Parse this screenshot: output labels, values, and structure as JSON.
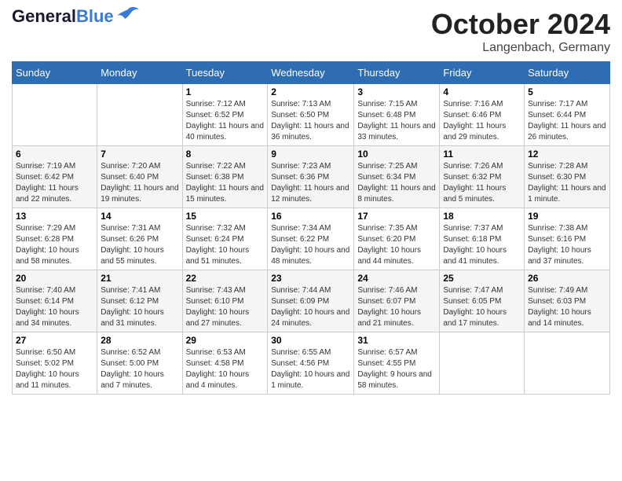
{
  "header": {
    "logo_text_general": "General",
    "logo_text_blue": "Blue",
    "month": "October 2024",
    "location": "Langenbach, Germany"
  },
  "weekdays": [
    "Sunday",
    "Monday",
    "Tuesday",
    "Wednesday",
    "Thursday",
    "Friday",
    "Saturday"
  ],
  "weeks": [
    [
      {
        "day": "",
        "sunrise": "",
        "sunset": "",
        "daylight": ""
      },
      {
        "day": "",
        "sunrise": "",
        "sunset": "",
        "daylight": ""
      },
      {
        "day": "1",
        "sunrise": "Sunrise: 7:12 AM",
        "sunset": "Sunset: 6:52 PM",
        "daylight": "Daylight: 11 hours and 40 minutes."
      },
      {
        "day": "2",
        "sunrise": "Sunrise: 7:13 AM",
        "sunset": "Sunset: 6:50 PM",
        "daylight": "Daylight: 11 hours and 36 minutes."
      },
      {
        "day": "3",
        "sunrise": "Sunrise: 7:15 AM",
        "sunset": "Sunset: 6:48 PM",
        "daylight": "Daylight: 11 hours and 33 minutes."
      },
      {
        "day": "4",
        "sunrise": "Sunrise: 7:16 AM",
        "sunset": "Sunset: 6:46 PM",
        "daylight": "Daylight: 11 hours and 29 minutes."
      },
      {
        "day": "5",
        "sunrise": "Sunrise: 7:17 AM",
        "sunset": "Sunset: 6:44 PM",
        "daylight": "Daylight: 11 hours and 26 minutes."
      }
    ],
    [
      {
        "day": "6",
        "sunrise": "Sunrise: 7:19 AM",
        "sunset": "Sunset: 6:42 PM",
        "daylight": "Daylight: 11 hours and 22 minutes."
      },
      {
        "day": "7",
        "sunrise": "Sunrise: 7:20 AM",
        "sunset": "Sunset: 6:40 PM",
        "daylight": "Daylight: 11 hours and 19 minutes."
      },
      {
        "day": "8",
        "sunrise": "Sunrise: 7:22 AM",
        "sunset": "Sunset: 6:38 PM",
        "daylight": "Daylight: 11 hours and 15 minutes."
      },
      {
        "day": "9",
        "sunrise": "Sunrise: 7:23 AM",
        "sunset": "Sunset: 6:36 PM",
        "daylight": "Daylight: 11 hours and 12 minutes."
      },
      {
        "day": "10",
        "sunrise": "Sunrise: 7:25 AM",
        "sunset": "Sunset: 6:34 PM",
        "daylight": "Daylight: 11 hours and 8 minutes."
      },
      {
        "day": "11",
        "sunrise": "Sunrise: 7:26 AM",
        "sunset": "Sunset: 6:32 PM",
        "daylight": "Daylight: 11 hours and 5 minutes."
      },
      {
        "day": "12",
        "sunrise": "Sunrise: 7:28 AM",
        "sunset": "Sunset: 6:30 PM",
        "daylight": "Daylight: 11 hours and 1 minute."
      }
    ],
    [
      {
        "day": "13",
        "sunrise": "Sunrise: 7:29 AM",
        "sunset": "Sunset: 6:28 PM",
        "daylight": "Daylight: 10 hours and 58 minutes."
      },
      {
        "day": "14",
        "sunrise": "Sunrise: 7:31 AM",
        "sunset": "Sunset: 6:26 PM",
        "daylight": "Daylight: 10 hours and 55 minutes."
      },
      {
        "day": "15",
        "sunrise": "Sunrise: 7:32 AM",
        "sunset": "Sunset: 6:24 PM",
        "daylight": "Daylight: 10 hours and 51 minutes."
      },
      {
        "day": "16",
        "sunrise": "Sunrise: 7:34 AM",
        "sunset": "Sunset: 6:22 PM",
        "daylight": "Daylight: 10 hours and 48 minutes."
      },
      {
        "day": "17",
        "sunrise": "Sunrise: 7:35 AM",
        "sunset": "Sunset: 6:20 PM",
        "daylight": "Daylight: 10 hours and 44 minutes."
      },
      {
        "day": "18",
        "sunrise": "Sunrise: 7:37 AM",
        "sunset": "Sunset: 6:18 PM",
        "daylight": "Daylight: 10 hours and 41 minutes."
      },
      {
        "day": "19",
        "sunrise": "Sunrise: 7:38 AM",
        "sunset": "Sunset: 6:16 PM",
        "daylight": "Daylight: 10 hours and 37 minutes."
      }
    ],
    [
      {
        "day": "20",
        "sunrise": "Sunrise: 7:40 AM",
        "sunset": "Sunset: 6:14 PM",
        "daylight": "Daylight: 10 hours and 34 minutes."
      },
      {
        "day": "21",
        "sunrise": "Sunrise: 7:41 AM",
        "sunset": "Sunset: 6:12 PM",
        "daylight": "Daylight: 10 hours and 31 minutes."
      },
      {
        "day": "22",
        "sunrise": "Sunrise: 7:43 AM",
        "sunset": "Sunset: 6:10 PM",
        "daylight": "Daylight: 10 hours and 27 minutes."
      },
      {
        "day": "23",
        "sunrise": "Sunrise: 7:44 AM",
        "sunset": "Sunset: 6:09 PM",
        "daylight": "Daylight: 10 hours and 24 minutes."
      },
      {
        "day": "24",
        "sunrise": "Sunrise: 7:46 AM",
        "sunset": "Sunset: 6:07 PM",
        "daylight": "Daylight: 10 hours and 21 minutes."
      },
      {
        "day": "25",
        "sunrise": "Sunrise: 7:47 AM",
        "sunset": "Sunset: 6:05 PM",
        "daylight": "Daylight: 10 hours and 17 minutes."
      },
      {
        "day": "26",
        "sunrise": "Sunrise: 7:49 AM",
        "sunset": "Sunset: 6:03 PM",
        "daylight": "Daylight: 10 hours and 14 minutes."
      }
    ],
    [
      {
        "day": "27",
        "sunrise": "Sunrise: 6:50 AM",
        "sunset": "Sunset: 5:02 PM",
        "daylight": "Daylight: 10 hours and 11 minutes."
      },
      {
        "day": "28",
        "sunrise": "Sunrise: 6:52 AM",
        "sunset": "Sunset: 5:00 PM",
        "daylight": "Daylight: 10 hours and 7 minutes."
      },
      {
        "day": "29",
        "sunrise": "Sunrise: 6:53 AM",
        "sunset": "Sunset: 4:58 PM",
        "daylight": "Daylight: 10 hours and 4 minutes."
      },
      {
        "day": "30",
        "sunrise": "Sunrise: 6:55 AM",
        "sunset": "Sunset: 4:56 PM",
        "daylight": "Daylight: 10 hours and 1 minute."
      },
      {
        "day": "31",
        "sunrise": "Sunrise: 6:57 AM",
        "sunset": "Sunset: 4:55 PM",
        "daylight": "Daylight: 9 hours and 58 minutes."
      },
      {
        "day": "",
        "sunrise": "",
        "sunset": "",
        "daylight": ""
      },
      {
        "day": "",
        "sunrise": "",
        "sunset": "",
        "daylight": ""
      }
    ]
  ]
}
